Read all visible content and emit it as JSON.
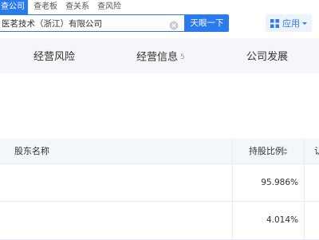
{
  "search": {
    "tabs": [
      "查公司",
      "查老板",
      "查关系",
      "查风险"
    ],
    "value": "医茗技术（浙江）有限公司",
    "button_label": "天眼一下"
  },
  "apps": {
    "label": "应用"
  },
  "main_tabs": [
    {
      "label": "经营风险",
      "count": ""
    },
    {
      "label": "经营信息",
      "count": "5"
    },
    {
      "label": "公司发展",
      "count": ""
    }
  ],
  "table": {
    "headers": {
      "name": "股东名称",
      "ratio": "持股比例",
      "next": "认"
    },
    "rows": [
      {
        "ratio": "95.986%"
      },
      {
        "ratio": "4.014%"
      }
    ]
  },
  "colors": {
    "accent": "#2a7bef",
    "header_bg": "#f3f6fb",
    "page_bg": "#f4f6fa"
  }
}
